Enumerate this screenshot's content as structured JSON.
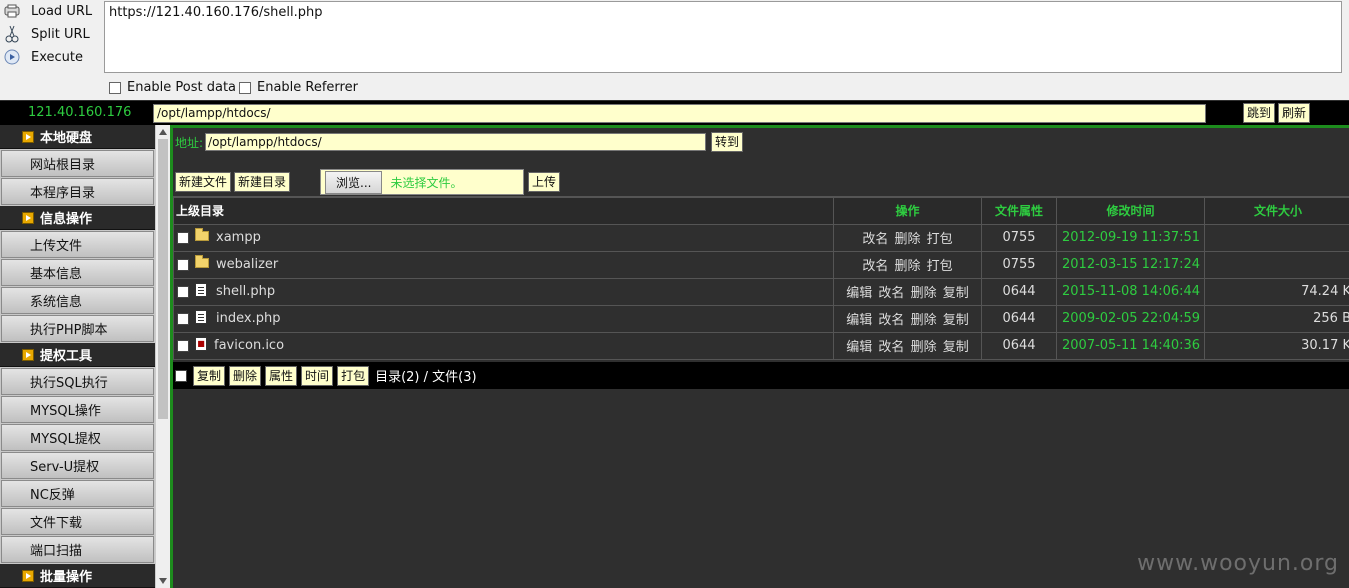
{
  "hackbar": {
    "load_url": "Load URL",
    "split_url": "Split URL",
    "execute": "Execute",
    "url": "https://121.40.160.176/shell.php",
    "enable_post": "Enable Post data",
    "enable_referrer": "Enable Referrer"
  },
  "shellbar": {
    "host": "121.40.160.176",
    "path": "/opt/lampp/htdocs/",
    "jump": "跳到",
    "refresh": "刷新"
  },
  "sidebar": {
    "sections": [
      {
        "title": "本地硬盘",
        "items": [
          "网站根目录",
          "本程序目录"
        ]
      },
      {
        "title": "信息操作",
        "items": [
          "上传文件",
          "基本信息",
          "系统信息",
          "执行PHP脚本"
        ]
      },
      {
        "title": "提权工具",
        "items": [
          "执行SQL执行",
          "MYSQL操作",
          "MYSQL提权",
          "Serv-U提权",
          "NC反弹",
          "文件下载",
          "端口扫描"
        ]
      },
      {
        "title": "批量操作",
        "items": []
      }
    ]
  },
  "main": {
    "address_label": "地址:",
    "address_value": "/opt/lampp/htdocs/",
    "goto": "转到",
    "new_file": "新建文件",
    "new_dir": "新建目录",
    "browse": "浏览...",
    "no_file": "未选择文件。",
    "upload": "上传",
    "headers": {
      "parent": "上级目录",
      "ops": "操作",
      "perm": "文件属性",
      "mtime": "修改时间",
      "size": "文件大小"
    },
    "rows": [
      {
        "name": "xampp",
        "type": "dir",
        "ops": [
          "改名",
          "删除",
          "打包"
        ],
        "perm": "0755",
        "mtime": "2012-09-19 11:37:51",
        "size": ""
      },
      {
        "name": "webalizer",
        "type": "dir",
        "ops": [
          "改名",
          "删除",
          "打包"
        ],
        "perm": "0755",
        "mtime": "2012-03-15 12:17:24",
        "size": ""
      },
      {
        "name": "shell.php",
        "type": "file",
        "ops": [
          "编辑",
          "改名",
          "删除",
          "复制"
        ],
        "perm": "0644",
        "mtime": "2015-11-08 14:06:44",
        "size": "74.24 K"
      },
      {
        "name": "index.php",
        "type": "file",
        "ops": [
          "编辑",
          "改名",
          "删除",
          "复制"
        ],
        "perm": "0644",
        "mtime": "2009-02-05 22:04:59",
        "size": "256 B"
      },
      {
        "name": "favicon.ico",
        "type": "ico",
        "ops": [
          "编辑",
          "改名",
          "删除",
          "复制"
        ],
        "perm": "0644",
        "mtime": "2007-05-11 14:40:36",
        "size": "30.17 K"
      }
    ],
    "footer": {
      "copy": "复制",
      "delete": "删除",
      "attr": "属性",
      "time": "时间",
      "pack": "打包",
      "summary": "目录(2) / 文件(3)"
    }
  },
  "watermark": "www.wooyun.org",
  "colors": {
    "accent_green": "#2ecc40",
    "input_yellow": "#ffffcc",
    "border_green": "#1d8c1d"
  }
}
